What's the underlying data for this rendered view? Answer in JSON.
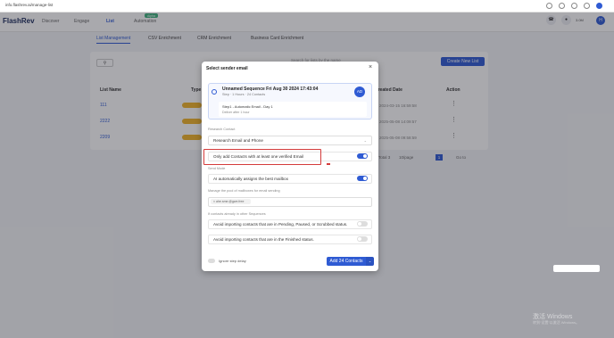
{
  "browser": {
    "url": "info.flashrev.ai/manage-list"
  },
  "app": {
    "logo": "FlashRev",
    "nav": [
      "Discover",
      "Engage",
      "List",
      "Automation"
    ],
    "beta_badge": "Alpha",
    "credits": "3.0M",
    "avatar_initial": "H"
  },
  "subtabs": [
    "List Management",
    "CSV Enrichment",
    "CRM Enrichment",
    "Business Card Enrichment"
  ],
  "toolbar": {
    "search_placeholder": "Search for lists by the name",
    "new_list_label": "Create New List"
  },
  "table": {
    "headers": [
      "List Name",
      "Type",
      "Created Date",
      "Action"
    ],
    "rows": [
      {
        "name": "111",
        "date": "2024-03-15 16:59:58"
      },
      {
        "name": "2222",
        "date": "2025-05-08 14:09:57"
      },
      {
        "name": "2209",
        "date": "2025-05-08 09:58:59"
      }
    ],
    "pager_total": "Total 3",
    "pager_size": "10/page",
    "pager_page": "1",
    "pager_goto": "Go to"
  },
  "modal": {
    "title": "Select sender email",
    "sequence": {
      "title": "Unnamed Sequence Fri Aug 30 2024 17:43:04",
      "meta": "Step · 1 Hours · 24 Contacts",
      "badge": "AD",
      "step_title": "Step1 - Automatic Email - Day 1",
      "step_sub": "Deliver after 1 hour"
    },
    "research_label": "Research Contact",
    "research_value": "Research Email and Phone",
    "verified_label": "Only add Contacts with at least one verified Email",
    "send_mode_label": "Send Mode",
    "send_mode_value": "AI automatically assigns the best mailbox",
    "pool_label": "Manage the pool of mailboxes for email sending",
    "pool_chip": "× ahe.sme.@gwe.free",
    "existing_label": "If contacts already in other Sequences",
    "avoid_pending_label": "Avoid importing contacts that are in Pending, Paused, or Scrubbed status.",
    "avoid_finished_label": "Avoid importing contacts that are in the Finished status.",
    "ignore_step_label": "Ignore step delay",
    "add_button_label": "Add 24 Contacts"
  },
  "os": {
    "watermark_title": "激活 Windows",
    "watermark_sub": "转到“设置”以激活 Windows。"
  },
  "colors": {
    "accent": "#2f5bd3",
    "highlight": "#d43c3c",
    "pill": "#f0b429"
  }
}
